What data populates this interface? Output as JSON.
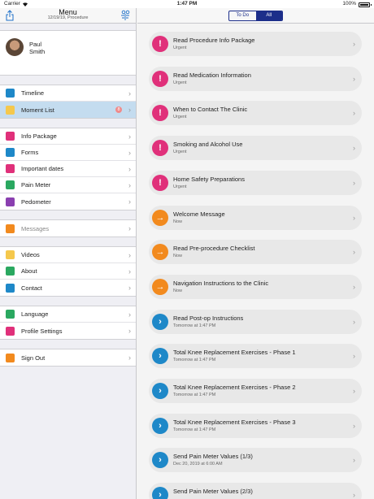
{
  "status_bar": {
    "carrier": "Carrier",
    "time": "1:47 PM",
    "battery": "100%"
  },
  "sidebar": {
    "title": "Menu",
    "subtitle": "12/19/19, Procedure",
    "profile": {
      "first_name": "Paul",
      "last_name": "Smith"
    },
    "groups": [
      {
        "items": [
          {
            "label": "Timeline",
            "icon": "timeline-icon",
            "color": "#1e88c8"
          },
          {
            "label": "Moment List",
            "icon": "moment-list-icon",
            "color": "#f5c84c",
            "badge": "8",
            "selected": true
          }
        ]
      },
      {
        "items": [
          {
            "label": "Info Package",
            "icon": "info-package-icon",
            "color": "#e0307a"
          },
          {
            "label": "Forms",
            "icon": "forms-icon",
            "color": "#1e88c8"
          },
          {
            "label": "Important dates",
            "icon": "calendar-icon",
            "color": "#e0307a"
          },
          {
            "label": "Pain Meter",
            "icon": "pain-meter-icon",
            "color": "#2aa860"
          },
          {
            "label": "Pedometer",
            "icon": "pedometer-icon",
            "color": "#8a3fb0"
          }
        ]
      },
      {
        "items": [
          {
            "label": "Messages",
            "icon": "messages-icon",
            "color": "#f28a1e",
            "disabled": true
          }
        ]
      },
      {
        "items": [
          {
            "label": "Videos",
            "icon": "videos-icon",
            "color": "#f5c84c"
          },
          {
            "label": "About",
            "icon": "about-icon",
            "color": "#2aa860"
          },
          {
            "label": "Contact",
            "icon": "contact-icon",
            "color": "#1e88c8"
          }
        ]
      },
      {
        "items": [
          {
            "label": "Language",
            "icon": "language-icon",
            "color": "#2aa860"
          },
          {
            "label": "Profile Settings",
            "icon": "profile-settings-icon",
            "color": "#e0307a"
          }
        ]
      },
      {
        "items": [
          {
            "label": "Sign Out",
            "icon": "sign-out-icon",
            "color": "#f28a1e"
          }
        ]
      }
    ]
  },
  "main": {
    "segments": [
      {
        "label": "To Do",
        "active": false
      },
      {
        "label": "All",
        "active": true
      }
    ],
    "moments": [
      {
        "title": "Read Procedure Info Package",
        "subtitle": "Urgent",
        "kind": "urgent"
      },
      {
        "title": "Read Medication Information",
        "subtitle": "Urgent",
        "kind": "urgent"
      },
      {
        "title": "When to Contact The Clinic",
        "subtitle": "Urgent",
        "kind": "urgent"
      },
      {
        "title": "Smoking and Alcohol Use",
        "subtitle": "Urgent",
        "kind": "urgent"
      },
      {
        "title": "Home Safety Preparations",
        "subtitle": "Urgent",
        "kind": "urgent"
      },
      {
        "title": "Welcome Message",
        "subtitle": "Now",
        "kind": "now"
      },
      {
        "title": "Read Pre-procedure Checklist",
        "subtitle": "Now",
        "kind": "now"
      },
      {
        "title": "Navigation Instructions to the Clinic",
        "subtitle": "Now",
        "kind": "now"
      },
      {
        "title": "Read Post-op Instructions",
        "subtitle": "Tomorrow at 1:47 PM",
        "kind": "later"
      },
      {
        "title": "Total Knee Replacement Exercises - Phase 1",
        "subtitle": "Tomorrow at 1:47 PM",
        "kind": "later"
      },
      {
        "title": "Total Knee Replacement Exercises - Phase 2",
        "subtitle": "Tomorrow at 1:47 PM",
        "kind": "later"
      },
      {
        "title": "Total Knee Replacement Exercises - Phase 3",
        "subtitle": "Tomorrow at 1:47 PM",
        "kind": "later"
      },
      {
        "title": "Send Pain Meter Values (1/3)",
        "subtitle": "Dec 20, 2019 at 6:00 AM",
        "kind": "later"
      },
      {
        "title": "Send Pain Meter Values (2/3)",
        "subtitle": "",
        "kind": "later"
      }
    ],
    "kind_glyphs": {
      "urgent": "!",
      "now": "→",
      "later": "›"
    }
  }
}
